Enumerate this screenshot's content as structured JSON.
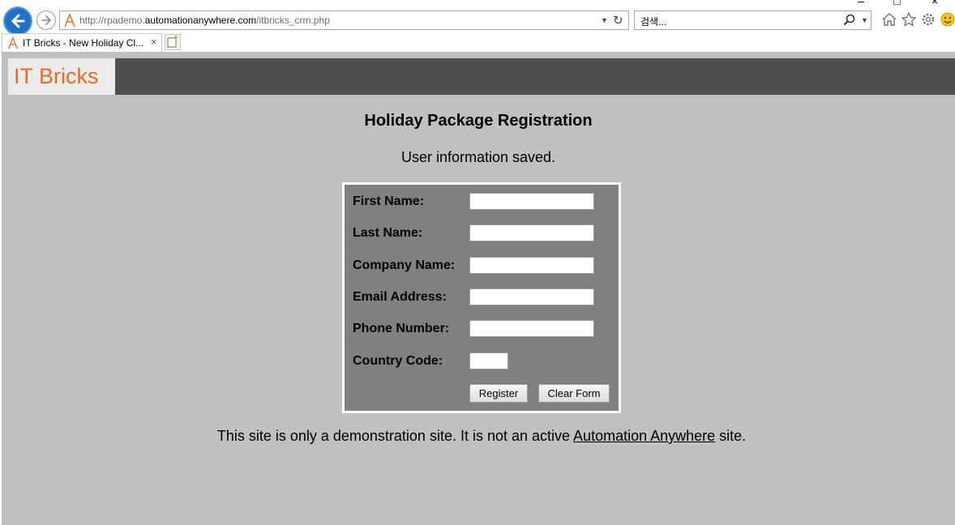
{
  "browser": {
    "address_prefix": "http://rpademo.",
    "address_domain": "automationanywhere.com",
    "address_suffix": "/itbricks_crm.php",
    "search_placeholder": "검색...",
    "tab_title": "IT Bricks - New Holiday Cl...",
    "tab_close": "×"
  },
  "header": {
    "logo_text": "IT Bricks",
    "logo_color": "#e96b23"
  },
  "main": {
    "heading": "Holiday Package Registration",
    "message": "User information saved."
  },
  "form": {
    "fields": [
      {
        "label": "First Name:",
        "value": ""
      },
      {
        "label": "Last Name:",
        "value": ""
      },
      {
        "label": "Company Name:",
        "value": ""
      },
      {
        "label": "Email Address:",
        "value": ""
      },
      {
        "label": "Phone Number:",
        "value": ""
      },
      {
        "label": "Country Code:",
        "value": ""
      }
    ],
    "register_label": "Register",
    "clear_label": "Clear Form"
  },
  "footer": {
    "text_before": "This site is only a demonstration site. It is not an active ",
    "link_text": "Automation Anywhere",
    "text_after": " site."
  },
  "colors": {
    "page_bg": "#c0c0c0",
    "header_bg": "#4f4f4f",
    "form_bg": "#808080"
  }
}
